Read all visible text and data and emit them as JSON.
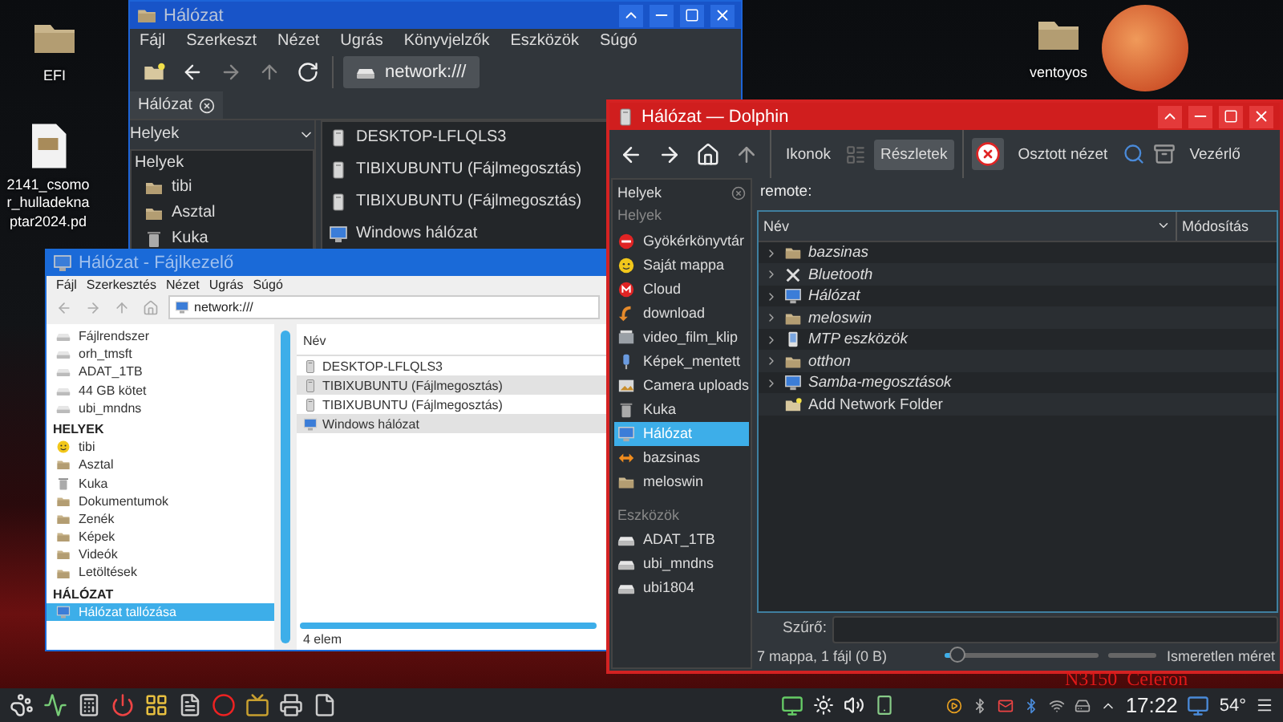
{
  "desktop": {
    "icons": [
      {
        "label": "EFI",
        "kind": "folder"
      },
      {
        "label": "2141_csomor_hulladeknaptar2024.pd",
        "kind": "document"
      },
      {
        "label": "ventoyos",
        "kind": "folder"
      }
    ],
    "overlay_text": "N3150  Celeron"
  },
  "back_window": {
    "title": "Hálózat",
    "menu": [
      "Fájl",
      "Szerkeszt",
      "Nézet",
      "Ugrás",
      "Könyvjelzők",
      "Eszközök",
      "Súgó"
    ],
    "location": "network:///",
    "tab": "Hálózat",
    "panel_title": "Helyek",
    "panel_heading": "Helyek",
    "places": [
      {
        "label": "tibi",
        "kind": "folder"
      },
      {
        "label": "Asztal",
        "kind": "folder"
      },
      {
        "label": "Kuka",
        "kind": "trash"
      }
    ],
    "items": [
      {
        "label": "DESKTOP-LFLQLS3",
        "kind": "server"
      },
      {
        "label": "TIBIXUBUNTU (Fájlmegosztás)",
        "kind": "server"
      },
      {
        "label": "TIBIXUBUNTU (Fájlmegosztás)",
        "kind": "server"
      },
      {
        "label": "Windows hálózat",
        "kind": "network"
      }
    ]
  },
  "file_manager": {
    "title": "Hálózat - Fájlkezelő",
    "menu": [
      "Fájl",
      "Szerkesztés",
      "Nézet",
      "Ugrás",
      "Súgó"
    ],
    "location": "network:///",
    "devices": [
      {
        "label": "Fájlrendszer",
        "kind": "drive",
        "selected": false
      },
      {
        "label": "orh_tmsft",
        "kind": "drive",
        "selected": false
      },
      {
        "label": "ADAT_1TB",
        "kind": "drive",
        "selected": false
      },
      {
        "label": "44 GB kötet",
        "kind": "drive",
        "selected": false
      },
      {
        "label": "ubi_mndns",
        "kind": "drive",
        "selected": false
      }
    ],
    "sections": [
      {
        "heading": "HELYEK",
        "items": [
          {
            "label": "tibi",
            "kind": "home",
            "selected": false
          },
          {
            "label": "Asztal",
            "kind": "folder",
            "selected": false
          },
          {
            "label": "Kuka",
            "kind": "trash",
            "selected": false
          },
          {
            "label": "Dokumentumok",
            "kind": "folder",
            "selected": false
          },
          {
            "label": "Zenék",
            "kind": "folder",
            "selected": false
          },
          {
            "label": "Képek",
            "kind": "folder",
            "selected": false
          },
          {
            "label": "Videók",
            "kind": "folder",
            "selected": false
          },
          {
            "label": "Letöltések",
            "kind": "folder",
            "selected": false
          }
        ]
      },
      {
        "heading": "HÁLÓZAT",
        "items": [
          {
            "label": "Hálózat tallózása",
            "kind": "network",
            "selected": true
          }
        ]
      }
    ],
    "column": "Név",
    "items": [
      {
        "label": "DESKTOP-LFLQLS3",
        "kind": "server"
      },
      {
        "label": "TIBIXUBUNTU (Fájlmegosztás)",
        "kind": "server"
      },
      {
        "label": "TIBIXUBUNTU (Fájlmegosztás)",
        "kind": "server"
      },
      {
        "label": "Windows hálózat",
        "kind": "network"
      }
    ],
    "status": "4 elem"
  },
  "dolphin": {
    "title": "Hálózat — Dolphin",
    "views": [
      {
        "label": "Ikonok",
        "selected": false
      },
      {
        "label": "Részletek",
        "selected": true
      }
    ],
    "split_label": "Osztott nézet",
    "control_label": "Vezérlő",
    "panel_title": "Helyek",
    "sections": [
      {
        "heading": "Helyek",
        "items": [
          {
            "label": "Gyökérkönyvtár",
            "kind": "root",
            "selected": false
          },
          {
            "label": "Saját mappa",
            "kind": "home",
            "selected": false
          },
          {
            "label": "Cloud",
            "kind": "cloud",
            "selected": false
          },
          {
            "label": "download",
            "kind": "download",
            "selected": false
          },
          {
            "label": "video_film_klip",
            "kind": "film",
            "selected": false
          },
          {
            "label": "Képek_mentett",
            "kind": "pictures",
            "selected": false
          },
          {
            "label": "Camera uploads",
            "kind": "camera",
            "selected": false
          },
          {
            "label": "Kuka",
            "kind": "trash",
            "selected": false
          },
          {
            "label": "Hálózat",
            "kind": "network",
            "selected": true
          },
          {
            "label": "bazsinas",
            "kind": "share",
            "selected": false
          },
          {
            "label": "meloswin",
            "kind": "folder",
            "selected": false
          }
        ]
      },
      {
        "heading": "Eszközök",
        "items": [
          {
            "label": "ADAT_1TB",
            "kind": "drive",
            "selected": false
          },
          {
            "label": "ubi_mndns",
            "kind": "drive",
            "selected": false
          },
          {
            "label": "ubi1804",
            "kind": "drive",
            "selected": false
          }
        ]
      }
    ],
    "path": "remote:",
    "columns": [
      "Név",
      "Módosítás"
    ],
    "rows": [
      {
        "label": "bazsinas",
        "kind": "folder",
        "expandable": true
      },
      {
        "label": "Bluetooth",
        "kind": "tools",
        "expandable": true
      },
      {
        "label": "Hálózat",
        "kind": "network",
        "expandable": true
      },
      {
        "label": "meloswin",
        "kind": "folder",
        "expandable": true
      },
      {
        "label": "MTP eszközök",
        "kind": "device",
        "expandable": true
      },
      {
        "label": "otthon",
        "kind": "folder",
        "expandable": true
      },
      {
        "label": "Samba-megosztások",
        "kind": "network",
        "expandable": true
      },
      {
        "label": "Add Network Folder",
        "kind": "new_folder",
        "expandable": false
      }
    ],
    "filter_label": "Szűrő:",
    "status": "7 mappa, 1 fájl (0 B)",
    "zoom": {
      "level": 0.08
    },
    "free_space": "Ismeretlen méret"
  },
  "taskbar": {
    "clock": "17:22",
    "temperature": "54°"
  }
}
